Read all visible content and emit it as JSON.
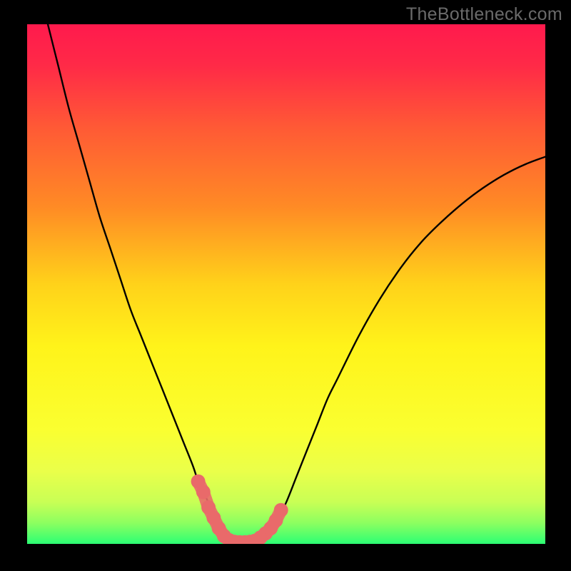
{
  "watermark": {
    "text": "TheBottleneck.com"
  },
  "colors": {
    "frame": "#000000",
    "gradient_stops": [
      {
        "offset": 0.0,
        "color": "#ff1a4d"
      },
      {
        "offset": 0.08,
        "color": "#ff2a47"
      },
      {
        "offset": 0.2,
        "color": "#ff5a35"
      },
      {
        "offset": 0.35,
        "color": "#ff8a25"
      },
      {
        "offset": 0.5,
        "color": "#ffd21a"
      },
      {
        "offset": 0.62,
        "color": "#fff31a"
      },
      {
        "offset": 0.78,
        "color": "#faff30"
      },
      {
        "offset": 0.86,
        "color": "#eaff4a"
      },
      {
        "offset": 0.92,
        "color": "#c8ff55"
      },
      {
        "offset": 0.96,
        "color": "#8cff60"
      },
      {
        "offset": 1.0,
        "color": "#2cff74"
      }
    ],
    "curve": "#000000",
    "markers_fill": "#e96a6a",
    "markers_stroke": "#c84f4f"
  },
  "chart_data": {
    "type": "line",
    "title": "",
    "xlabel": "",
    "ylabel": "",
    "xlim": [
      0,
      100
    ],
    "ylim": [
      0,
      100
    ],
    "grid": false,
    "series": [
      {
        "name": "bottleneck-curve",
        "x": [
          4,
          6,
          8,
          10,
          12,
          14,
          16,
          18,
          20,
          22,
          24,
          26,
          28,
          30,
          32,
          33,
          34,
          36,
          38,
          40,
          42,
          44,
          46,
          48,
          50,
          52,
          54,
          56,
          58,
          60,
          64,
          68,
          72,
          76,
          80,
          84,
          88,
          92,
          96,
          100
        ],
        "y": [
          100,
          92,
          84,
          77,
          70,
          63,
          57,
          51,
          45,
          40,
          35,
          30,
          25,
          20,
          15,
          12,
          10,
          6,
          3,
          1.2,
          0.5,
          0.5,
          1.5,
          4,
          8,
          13,
          18,
          23,
          28,
          32,
          40,
          47,
          53,
          58,
          62,
          65.5,
          68.5,
          71,
          73,
          74.5
        ]
      }
    ],
    "markers": [
      {
        "x": 33.0,
        "y": 12.0
      },
      {
        "x": 34.0,
        "y": 10.0
      },
      {
        "x": 35.0,
        "y": 7.0
      },
      {
        "x": 36.0,
        "y": 5.0
      },
      {
        "x": 37.0,
        "y": 3.0
      },
      {
        "x": 38.0,
        "y": 1.5
      },
      {
        "x": 39.0,
        "y": 0.7
      },
      {
        "x": 40.0,
        "y": 0.4
      },
      {
        "x": 41.0,
        "y": 0.3
      },
      {
        "x": 42.0,
        "y": 0.3
      },
      {
        "x": 43.0,
        "y": 0.4
      },
      {
        "x": 44.0,
        "y": 0.6
      },
      {
        "x": 45.0,
        "y": 1.2
      },
      {
        "x": 46.0,
        "y": 2.0
      },
      {
        "x": 47.0,
        "y": 3.0
      },
      {
        "x": 48.0,
        "y": 4.5
      },
      {
        "x": 49.0,
        "y": 6.5
      }
    ]
  }
}
